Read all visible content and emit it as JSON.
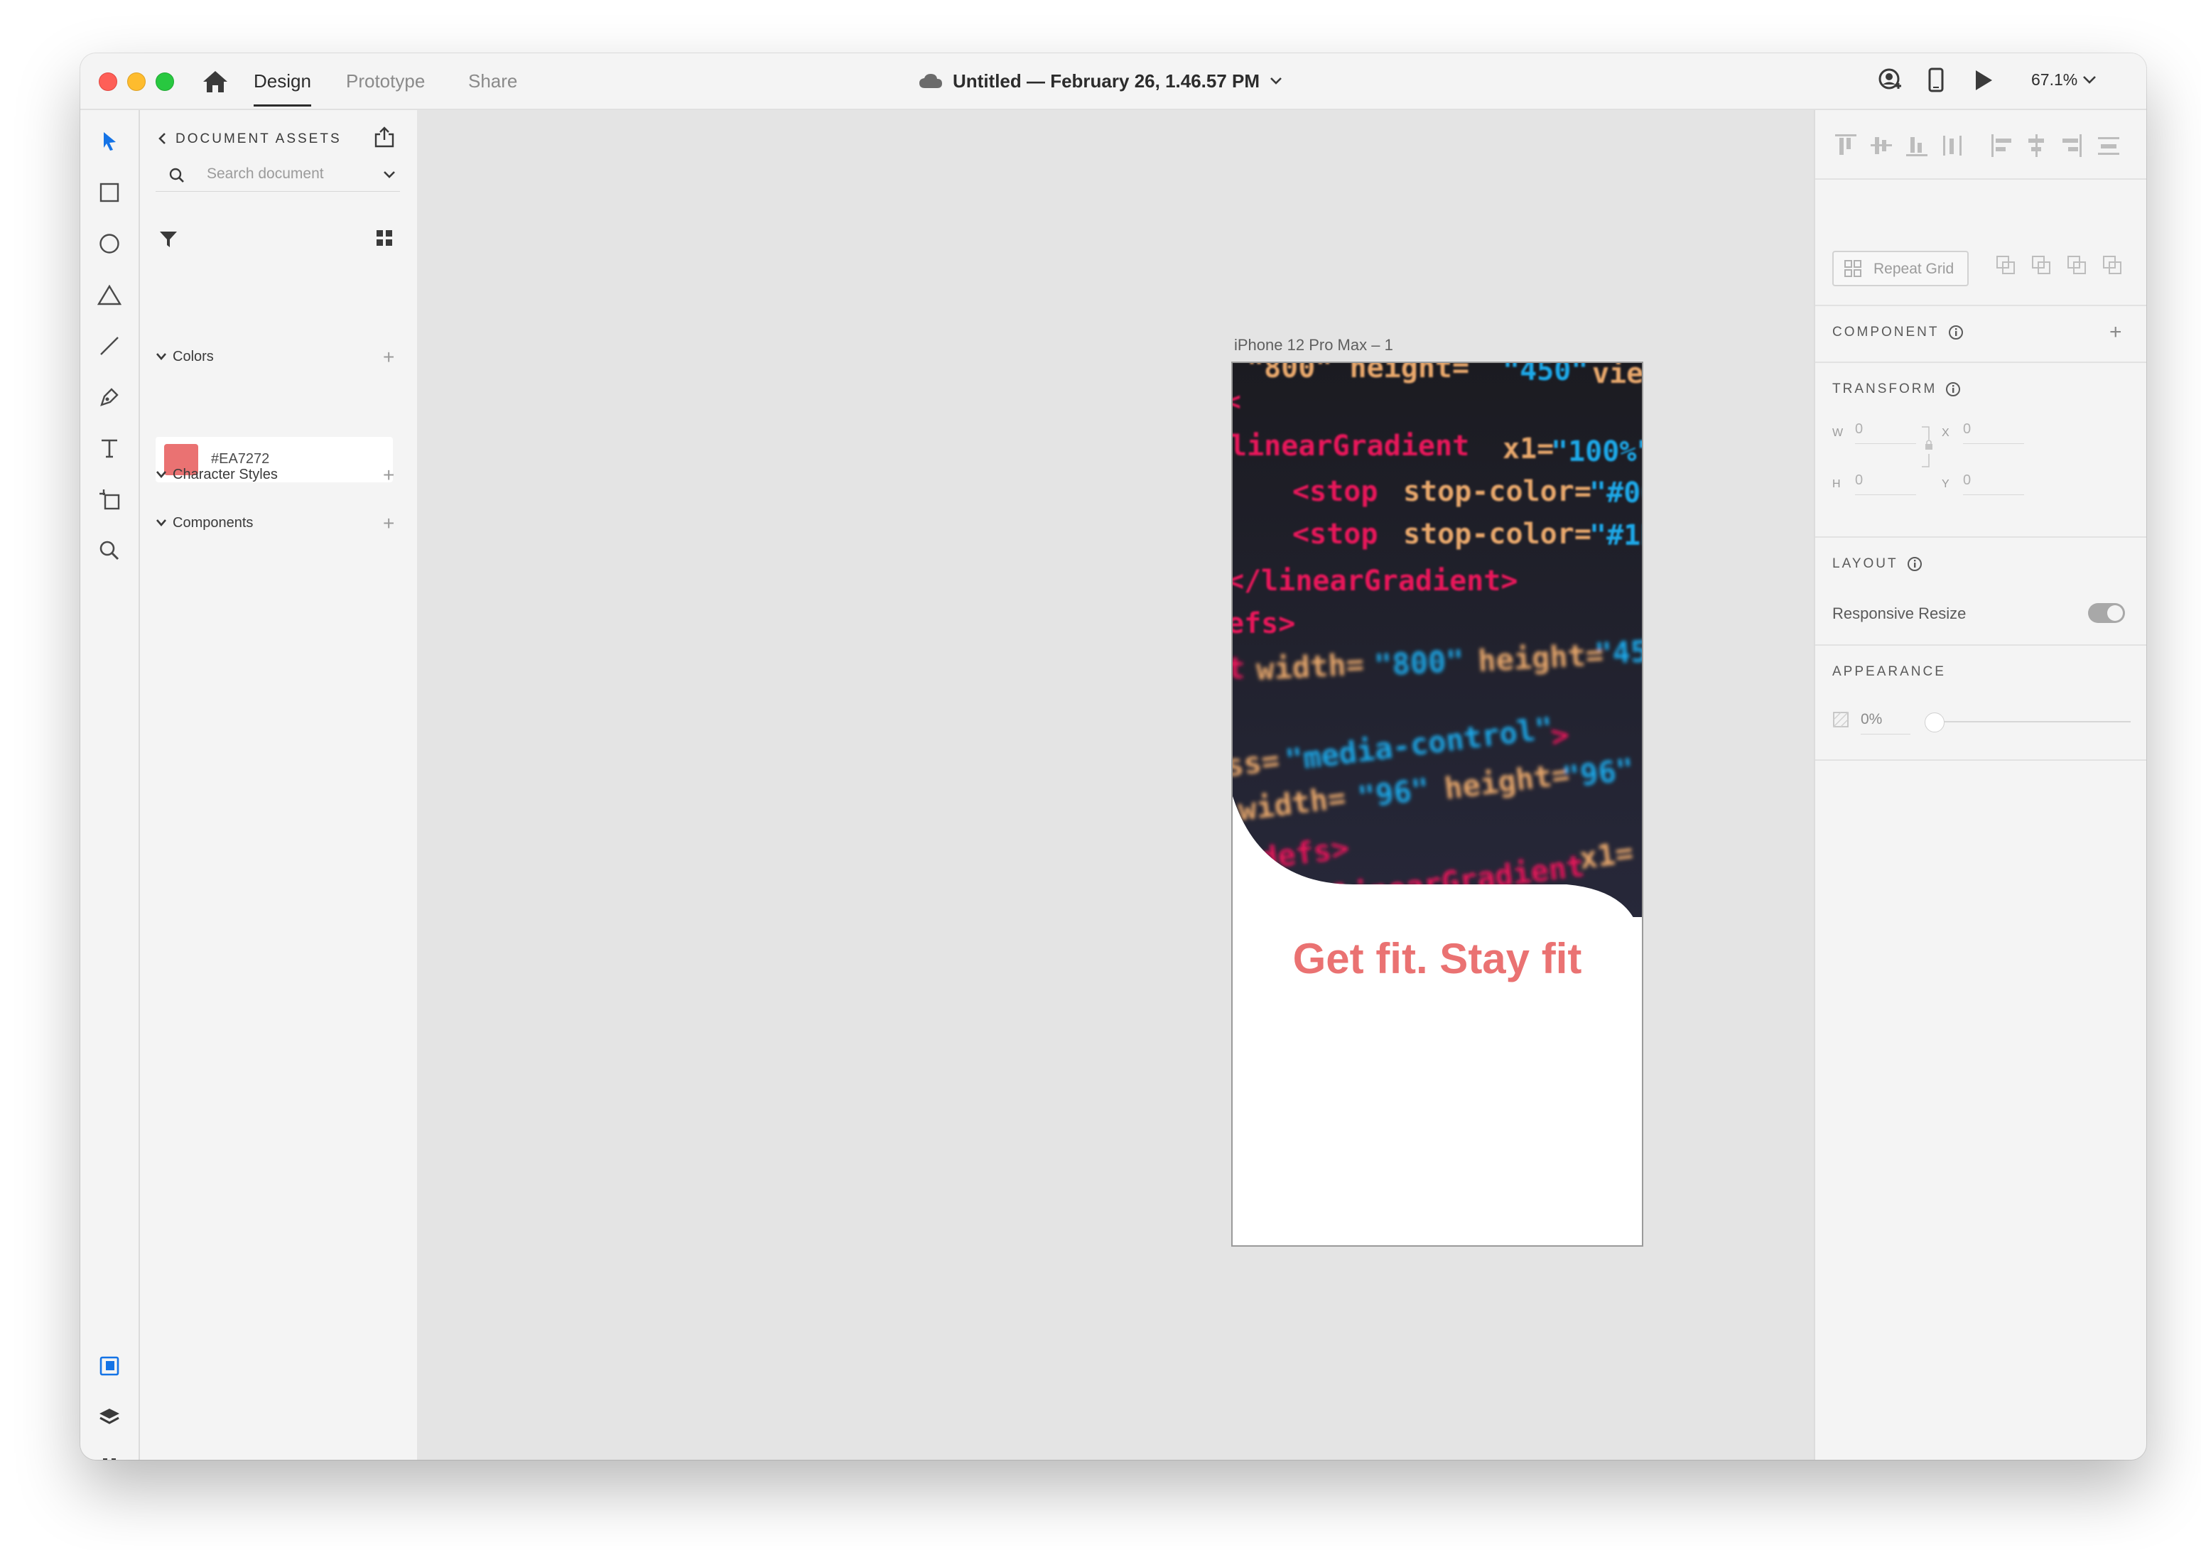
{
  "titlebar": {
    "tabs": {
      "design": "Design",
      "prototype": "Prototype",
      "share": "Share"
    },
    "document_title": "Untitled — February 26, 1.46.57 PM",
    "zoom": "67.1%"
  },
  "assets_panel": {
    "header": "DOCUMENT ASSETS",
    "search_placeholder": "Search document",
    "sections": {
      "colors": "Colors",
      "character_styles": "Character Styles",
      "components": "Components"
    },
    "colors": [
      {
        "hex": "#EA7272",
        "label": "#EA7272"
      }
    ]
  },
  "canvas": {
    "artboard_label": "iPhone 12 Pro Max – 1",
    "headline": "Get fit. Stay fit",
    "headline_color": "#EA7272"
  },
  "properties": {
    "repeat_grid": "Repeat Grid",
    "component": "COMPONENT",
    "transform": "TRANSFORM",
    "w_label": "W",
    "w_value": "0",
    "x_label": "X",
    "x_value": "0",
    "h_label": "H",
    "h_value": "0",
    "y_label": "Y",
    "y_value": "0",
    "layout": "LAYOUT",
    "responsive_resize": "Responsive Resize",
    "appearance": "APPEARANCE",
    "opacity": "0%"
  },
  "colors": {
    "accent_blue": "#1473e6",
    "code_pink": "#e8195a",
    "code_orange": "#e9a86c",
    "code_blue": "#1aa8e8",
    "code_bg": "#1f1f25"
  }
}
